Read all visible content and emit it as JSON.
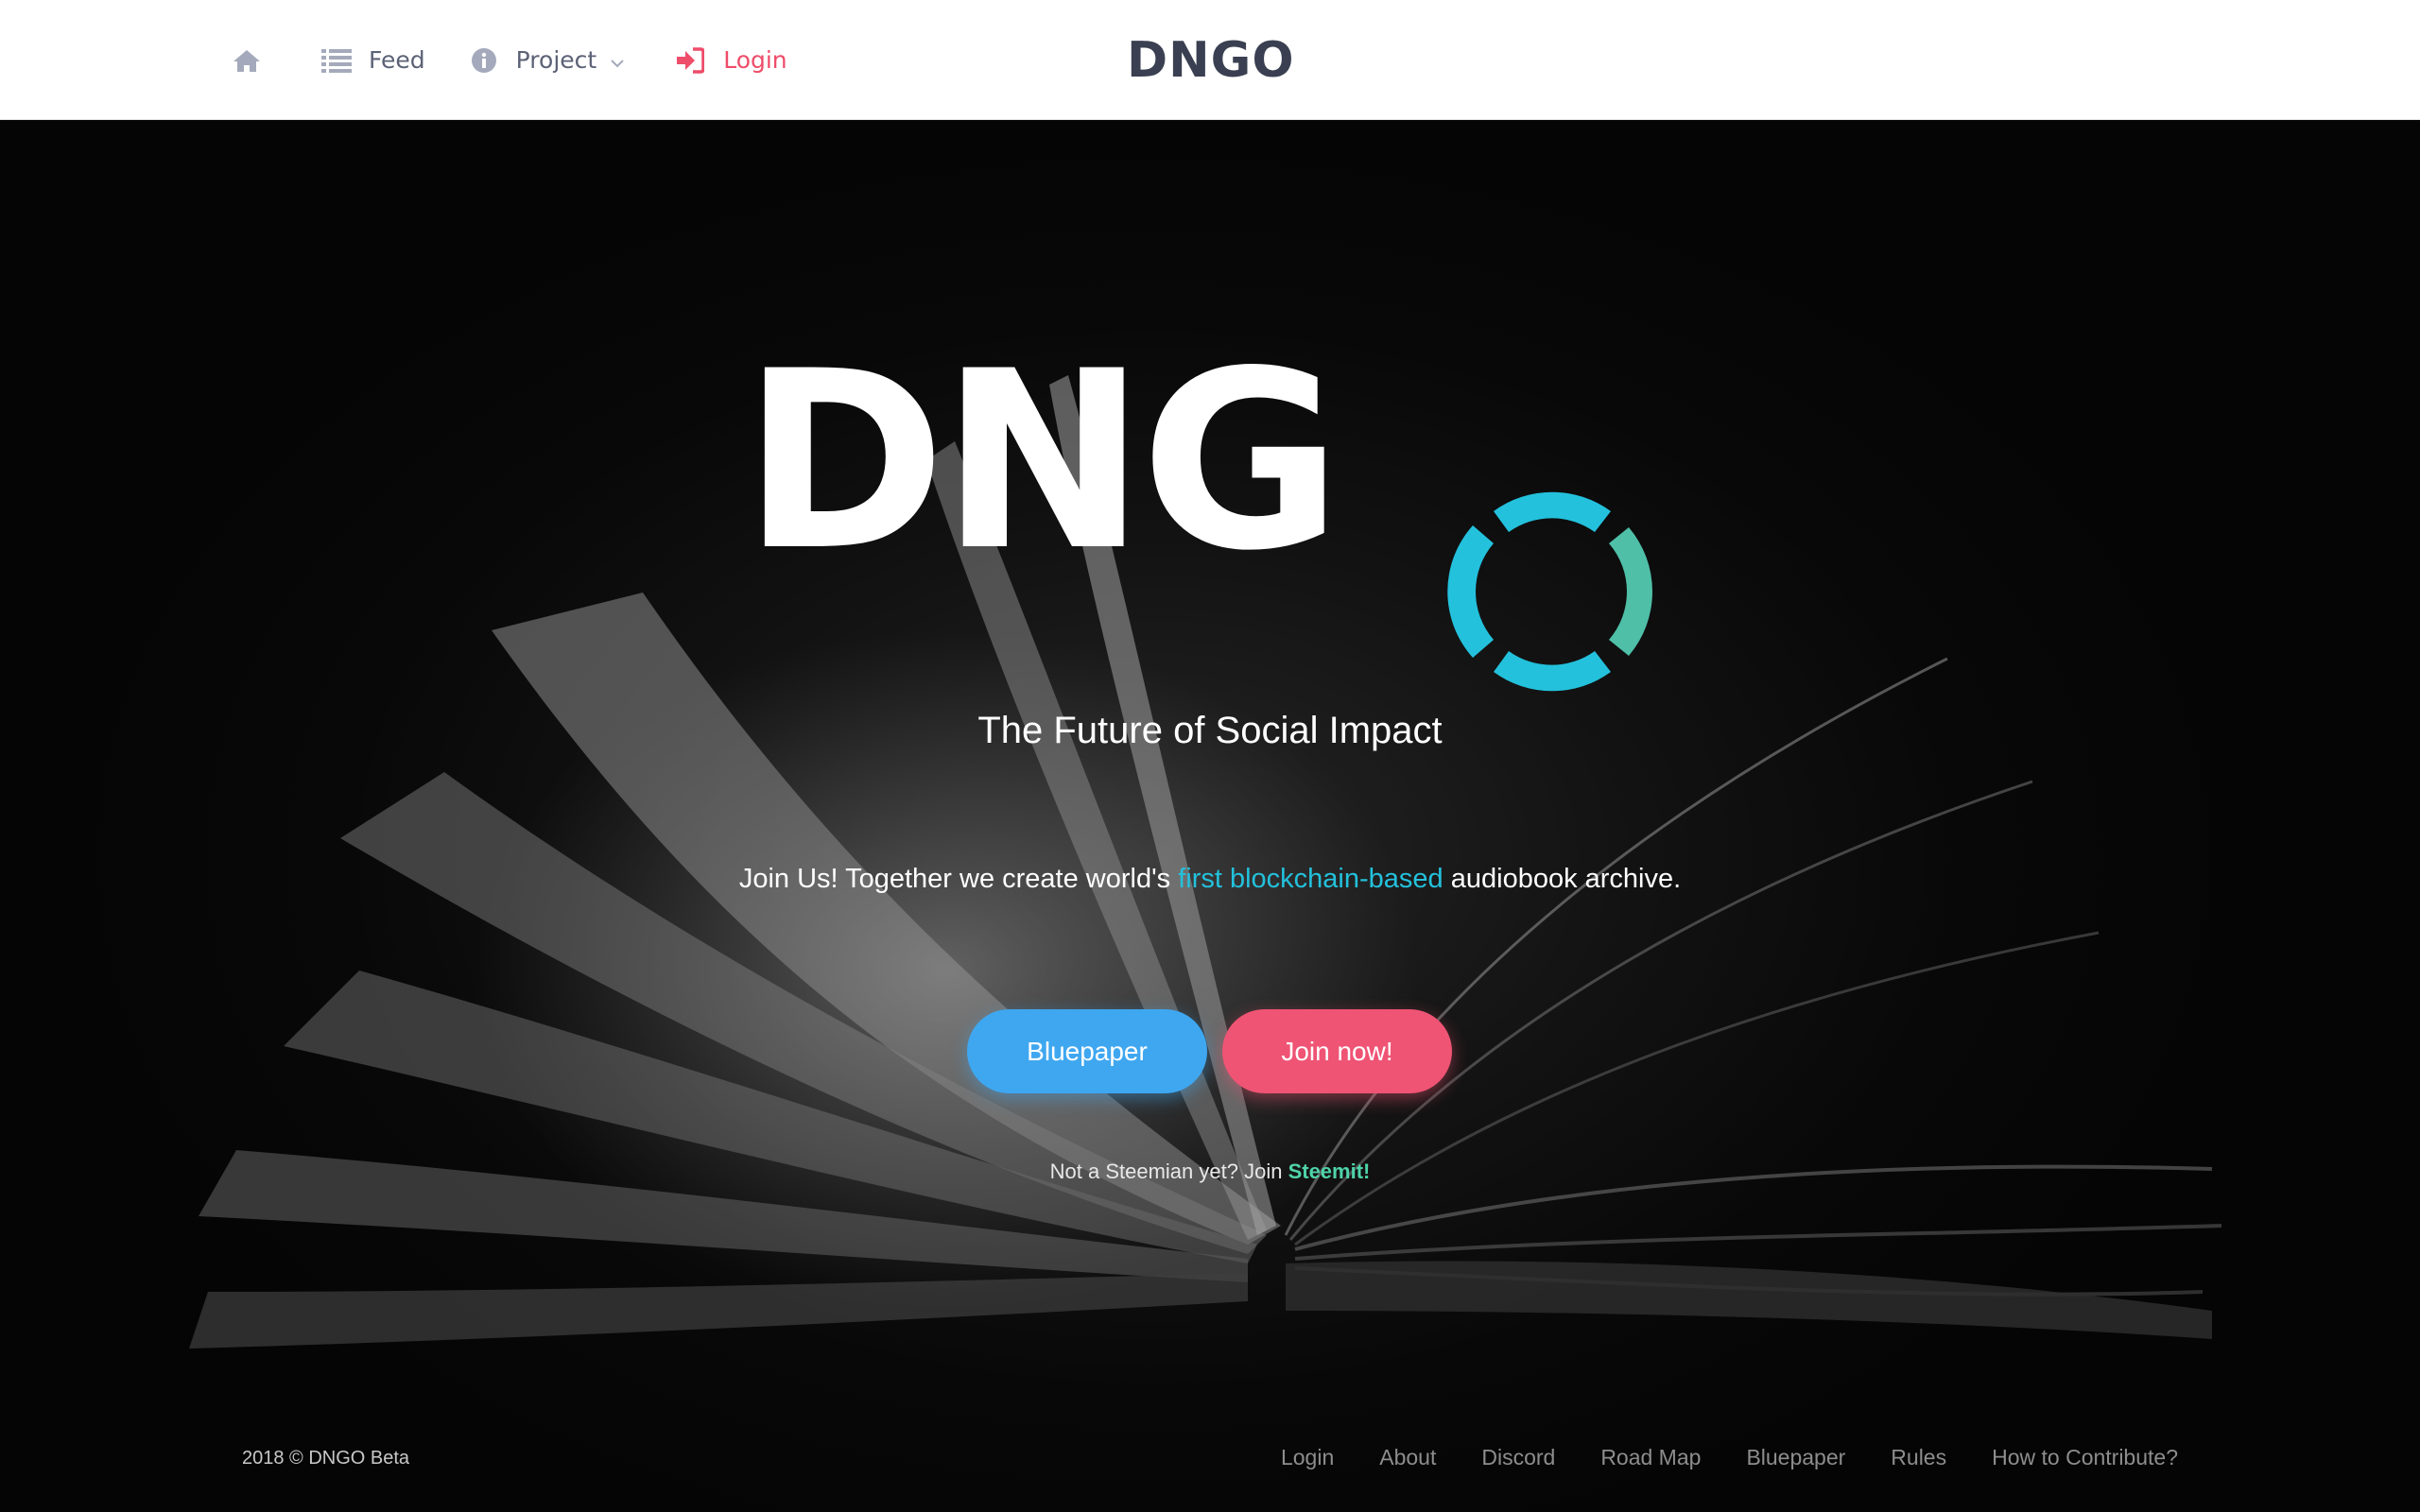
{
  "header": {
    "nav": {
      "home_icon": "home-icon",
      "feed_label": "Feed",
      "feed_icon": "list-icon",
      "project_label": "Project",
      "project_icon": "info-circle-icon",
      "login_label": "Login",
      "login_icon": "sign-in-icon"
    },
    "logo_text": "DNGO"
  },
  "hero": {
    "logo_text": "DNG",
    "tagline": "The Future of Social Impact",
    "intro_prefix": "Join Us! Together we create world's ",
    "intro_highlight": "first blockchain-based",
    "intro_suffix": " audiobook archive.",
    "buttons": {
      "bluepaper": "Bluepaper",
      "join": "Join now!"
    },
    "steem_note_prefix": "Not a Steemian yet? Join ",
    "steem_link": "Steemit!"
  },
  "footer": {
    "copyright": "2018 © DNGO Beta",
    "links": [
      "Login",
      "About",
      "Discord",
      "Road Map",
      "Bluepaper",
      "Rules",
      "How to Contribute?"
    ]
  },
  "colors": {
    "brand_dark": "#3a4051",
    "accent_cyan": "#23c1dc",
    "accent_teal": "#4fbfa8",
    "login_red": "#ee4d6a",
    "button_blue": "#3fa7f0",
    "button_pink": "#ef5474",
    "steemit_green": "#4fd3a9"
  }
}
